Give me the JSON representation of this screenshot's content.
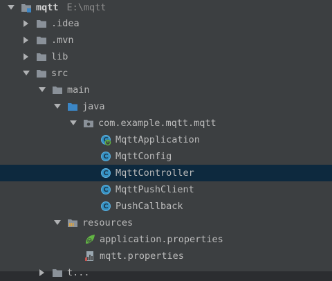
{
  "tree": {
    "root": {
      "label": "mqtt",
      "path": "E:\\mqtt"
    },
    "idea": {
      "label": ".idea"
    },
    "mvn": {
      "label": ".mvn"
    },
    "lib": {
      "label": "lib"
    },
    "src": {
      "label": "src"
    },
    "main": {
      "label": "main"
    },
    "java": {
      "label": "java"
    },
    "package": {
      "label": "com.example.mqtt.mqtt"
    },
    "classes": [
      {
        "label": "MqttApplication",
        "icon": "spring-boot-class-icon"
      },
      {
        "label": "MqttConfig",
        "icon": "class-icon"
      },
      {
        "label": "MqttController",
        "icon": "class-icon",
        "selected": true
      },
      {
        "label": "MqttPushClient",
        "icon": "class-icon"
      },
      {
        "label": "PushCallback",
        "icon": "class-icon"
      }
    ],
    "resources": {
      "label": "resources"
    },
    "resource_files": [
      {
        "label": "application.properties",
        "icon": "spring-properties-icon"
      },
      {
        "label": "mqtt.properties",
        "icon": "properties-file-icon"
      }
    ],
    "next": {
      "label": "t..."
    }
  },
  "colors": {
    "background": "#3c3f41",
    "selection": "#0d293e",
    "folder": "#8a9199",
    "source_folder": "#3b86c5",
    "class_icon": "#3592c4"
  }
}
